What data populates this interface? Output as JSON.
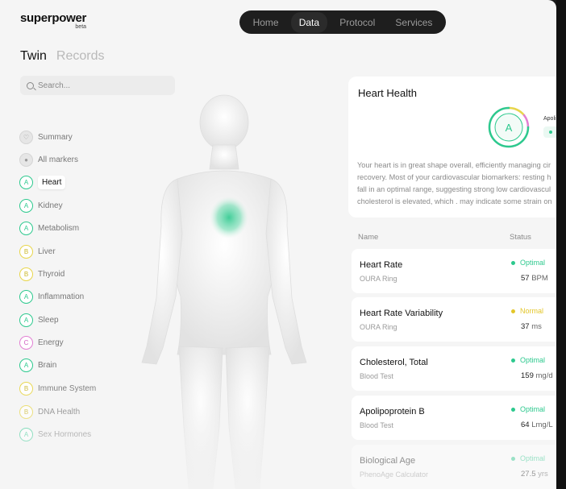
{
  "brand": {
    "name": "superpower",
    "tag": "beta"
  },
  "nav": {
    "items": [
      "Home",
      "Data",
      "Protocol",
      "Services"
    ],
    "active": "Data"
  },
  "view_tabs": {
    "items": [
      "Twin",
      "Records"
    ],
    "active": "Twin"
  },
  "search": {
    "placeholder": "Search..."
  },
  "sidebar": {
    "items": [
      {
        "label": "Summary",
        "grade": "",
        "kind": "neutral"
      },
      {
        "label": "All markers",
        "grade": "",
        "kind": "neutral"
      },
      {
        "label": "Heart",
        "grade": "A",
        "kind": "a",
        "active": true
      },
      {
        "label": "Kidney",
        "grade": "A",
        "kind": "a"
      },
      {
        "label": "Metabolism",
        "grade": "A",
        "kind": "a"
      },
      {
        "label": "Liver",
        "grade": "B",
        "kind": "b"
      },
      {
        "label": "Thyroid",
        "grade": "B",
        "kind": "b"
      },
      {
        "label": "Inflammation",
        "grade": "A",
        "kind": "a"
      },
      {
        "label": "Sleep",
        "grade": "A",
        "kind": "a"
      },
      {
        "label": "Energy",
        "grade": "C",
        "kind": "c"
      },
      {
        "label": "Brain",
        "grade": "A",
        "kind": "a"
      },
      {
        "label": "Immune System",
        "grade": "B",
        "kind": "b"
      },
      {
        "label": "DNA Health",
        "grade": "B",
        "kind": "b"
      },
      {
        "label": "Sex Hormones",
        "grade": "A",
        "kind": "a"
      }
    ]
  },
  "heart_card": {
    "title": "Heart Health",
    "grade": "A",
    "side_label": "Apoli",
    "text_lines": [
      "Your heart is in great shape overall, efficiently managing cir",
      "recovery. Most of your cardiovascular biomarkers: resting h",
      "fall in an optimal range, suggesting strong low cardiovascul",
      "cholesterol is elevated, which . may indicate some strain on"
    ]
  },
  "table": {
    "headers": {
      "name": "Name",
      "status": "Status"
    },
    "rows": [
      {
        "name": "Heart Rate",
        "source": "OURA Ring",
        "status": "Optimal",
        "value": "57",
        "unit": "BPM"
      },
      {
        "name": "Heart Rate Variability",
        "source": "OURA Ring",
        "status": "Normal",
        "value": "37",
        "unit": "ms"
      },
      {
        "name": "Cholesterol, Total",
        "source": "Blood Test",
        "status": "Optimal",
        "value": "159",
        "unit": "mg/d"
      },
      {
        "name": "Apolipoprotein B",
        "source": "Blood Test",
        "status": "Optimal",
        "value": "64",
        "unit": "Lmg/L"
      },
      {
        "name": "Biological Age",
        "source": "PhenoAge Calculator",
        "status": "Optimal",
        "value": "27.5",
        "unit": "yrs"
      }
    ]
  },
  "colors": {
    "optimal": "#2dc98e",
    "normal": "#e3c62a",
    "grade_b": "#e8d64a",
    "grade_c": "#e27fd3",
    "nav_bg": "#1e1e1e"
  }
}
